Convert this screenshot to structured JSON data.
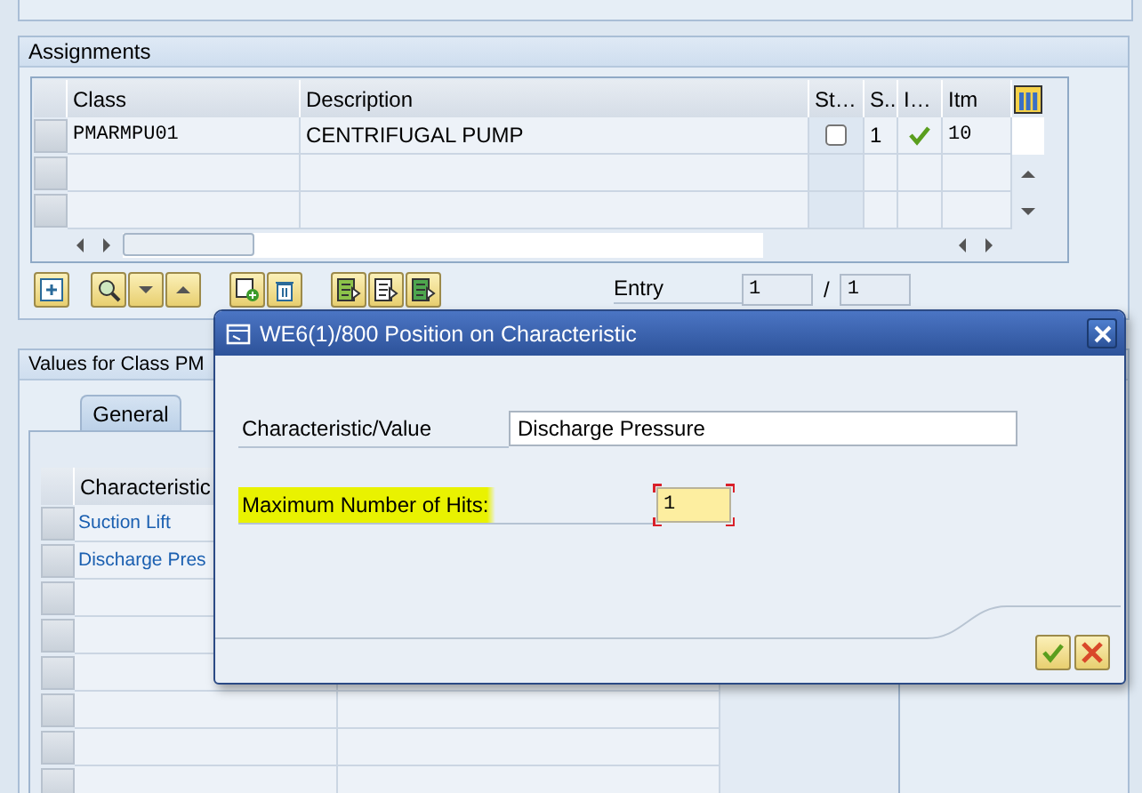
{
  "assignments": {
    "title": "Assignments",
    "columns": [
      "Class",
      "Description",
      "St…",
      "S..",
      "I…",
      "Itm"
    ],
    "rows": [
      {
        "class": "PMARMPU01",
        "description": "CENTRIFUGAL PUMP",
        "checked": false,
        "s": "1",
        "ok": true,
        "itm": "10"
      }
    ],
    "entry": {
      "label": "Entry",
      "current": "1",
      "separator": "/",
      "total": "1"
    }
  },
  "values_panel": {
    "title": "Values for Class PM",
    "tabs": [
      {
        "label": "General",
        "selected": true
      }
    ],
    "columns": [
      "Characteristic"
    ],
    "rows": [
      "Suction Lift",
      "Discharge Pres"
    ]
  },
  "dialog": {
    "title": "WE6(1)/800 Position on Characteristic",
    "fields": [
      {
        "kind": "text",
        "label": "Characteristic/Value",
        "value": "Discharge Pressure",
        "highlighted": false
      },
      {
        "kind": "required",
        "label": "Maximum Number of Hits:",
        "value": "1",
        "highlighted": true
      }
    ]
  }
}
